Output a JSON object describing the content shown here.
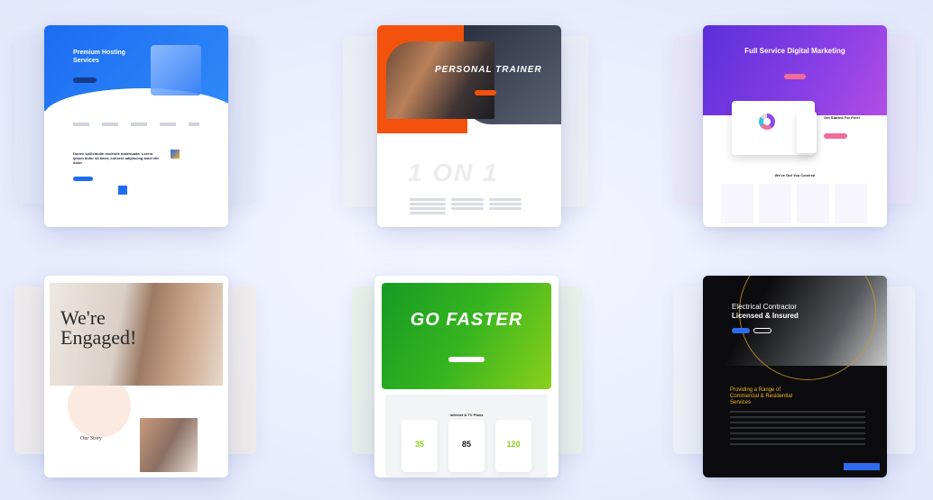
{
  "cards": [
    {
      "name": "premium-hosting",
      "title": "Premium Hosting Services",
      "body": "Donec sollicitudin molestie malesuada. Lorem ipsum dolor sit amet, consect adipiscing amet elit dolor"
    },
    {
      "name": "personal-trainer",
      "title": "PERSONAL TRAINER",
      "big": "1 ON 1"
    },
    {
      "name": "digital-marketing",
      "title": "Full Service Digital Marketing",
      "cta": "Get Started For Free!",
      "section": "We've Got You Covered"
    },
    {
      "name": "wedding",
      "title": "We're Engaged!",
      "section": "Our Story"
    },
    {
      "name": "isp",
      "title": "GO FASTER",
      "section": "Internet & TV Plans",
      "prices": [
        "35",
        "85",
        "120"
      ]
    },
    {
      "name": "electrical-contractor",
      "title_line1": "Electrical Contractor",
      "title_line2": "Licensed & Insured",
      "section": "Providing a Range of Commercial & Residential Services"
    }
  ],
  "colors": {
    "hosting_blue": "#1d6cf2",
    "trainer_orange": "#f2520c",
    "marketing_purple": "#6a35de",
    "isp_green": "#37b51f",
    "contractor_gold": "#f0b429"
  }
}
